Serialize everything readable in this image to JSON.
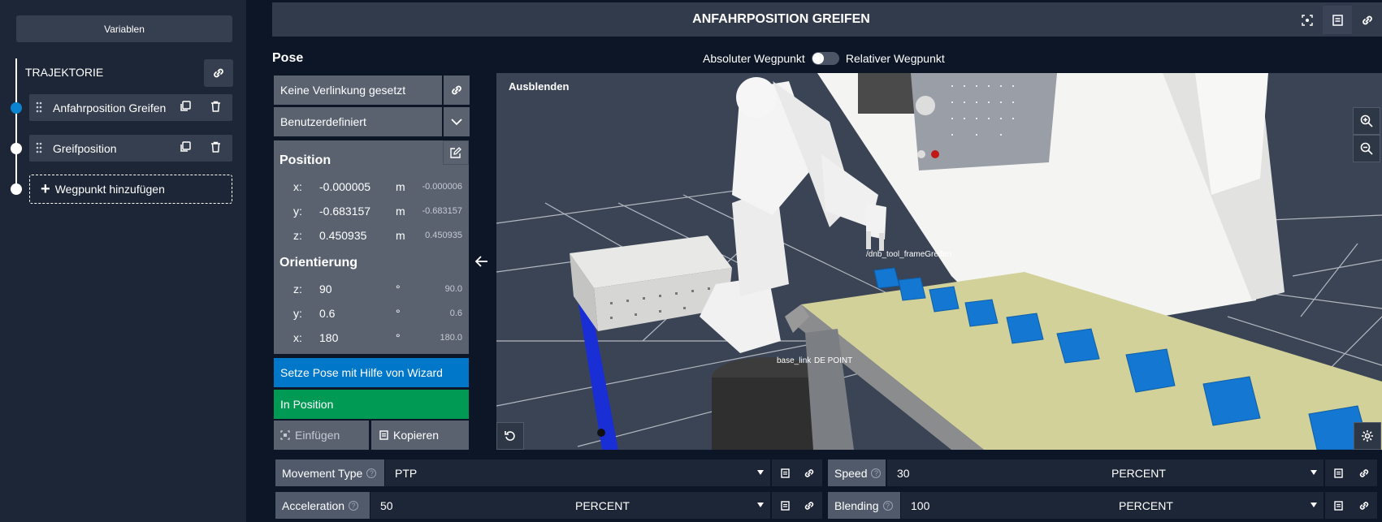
{
  "sidebar": {
    "variables_label": "Variablen",
    "trajectory_title": "TRAJEKTORIE",
    "waypoints": [
      {
        "label": "Anfahrposition Greifen",
        "active": true
      },
      {
        "label": "Greifposition",
        "active": false
      }
    ],
    "add_waypoint_label": "Wegpunkt hinzufügen"
  },
  "header": {
    "title": "ANFAHRPOSITION GREIFEN"
  },
  "pose": {
    "title": "Pose",
    "toggle_left": "Absoluter Wegpunkt",
    "toggle_right": "Relativer Wegpunkt",
    "link_label": "Keine Verlinkung gesetzt",
    "frame_label": "Benutzerdefiniert",
    "position_title": "Position",
    "position": [
      {
        "axis": "x:",
        "value": "-0.000005",
        "unit": "m",
        "original": "-0.000006"
      },
      {
        "axis": "y:",
        "value": "-0.683157",
        "unit": "m",
        "original": "-0.683157"
      },
      {
        "axis": "z:",
        "value": "0.450935",
        "unit": "m",
        "original": "0.450935"
      }
    ],
    "orientation_title": "Orientierung",
    "orientation": [
      {
        "axis": "z:",
        "value": "90",
        "unit": "°",
        "original": "90.0"
      },
      {
        "axis": "y:",
        "value": "0.6",
        "unit": "°",
        "original": "0.6"
      },
      {
        "axis": "x:",
        "value": "180",
        "unit": "°",
        "original": "180.0"
      }
    ],
    "wizard_label": "Setze Pose mit Hilfe von Wizard",
    "in_position_label": "In Position",
    "paste_label": "Einfügen",
    "copy_label": "Kopieren"
  },
  "viewport": {
    "hide_label": "Ausblenden",
    "tool_frame_label": "/dnb_tool_frameGreifen",
    "base_label": "base_link",
    "point_label": "DE POINT"
  },
  "params": {
    "movement_type": {
      "label": "Movement Type",
      "value": "PTP"
    },
    "speed": {
      "label": "Speed",
      "value": "30",
      "unit": "PERCENT"
    },
    "acceleration": {
      "label": "Acceleration",
      "value": "50",
      "unit": "PERCENT"
    },
    "blending": {
      "label": "Blending",
      "value": "100",
      "unit": "PERCENT"
    }
  },
  "colors": {
    "active_dot": "#0a84d0",
    "wizard": "#0077c8",
    "in_position": "#009a54"
  }
}
